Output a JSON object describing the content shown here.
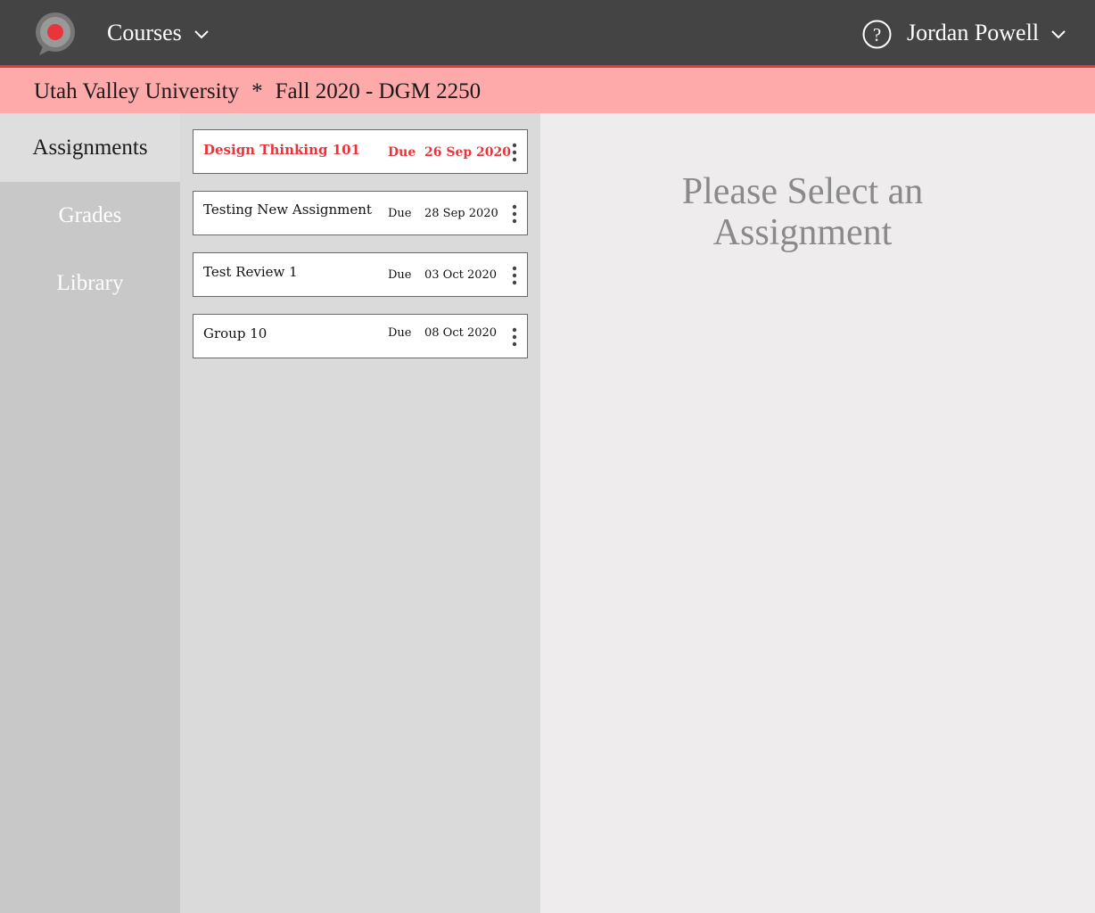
{
  "header": {
    "logo_icon": "chat-bubble-logo-icon",
    "courses_label": "Courses",
    "help_icon": "question-circle-icon",
    "user_name": "Jordan Powell"
  },
  "breadcrumb": {
    "institution": "Utah Valley University",
    "separator": "*",
    "course": "Fall 2020 - DGM 2250"
  },
  "sidebar": {
    "items": [
      {
        "label": "Assignments",
        "active": true
      },
      {
        "label": "Grades",
        "active": false
      },
      {
        "label": "Library",
        "active": false
      }
    ]
  },
  "assignments": [
    {
      "title": "Design Thinking 101",
      "due_label": "Due",
      "date": "26 Sep 2020",
      "highlighted": true
    },
    {
      "title": "Testing New Assignment",
      "due_label": "Due",
      "date": "28 Sep 2020",
      "highlighted": false
    },
    {
      "title": "Test Review 1",
      "due_label": "Due",
      "date": "03 Oct 2020",
      "highlighted": false
    },
    {
      "title": "Group 10",
      "due_label": "Due",
      "date": "08 Oct 2020",
      "highlighted": false
    }
  ],
  "main": {
    "placeholder_line1": "Please Select an",
    "placeholder_line2": "Assignment"
  },
  "colors": {
    "topbar": "#444444",
    "accent": "#e8353b",
    "breadcrumb_bg": "#ffaaaa",
    "sidebar_bg": "#c8c8c8",
    "list_bg": "#dadada",
    "main_bg": "#eeecec"
  }
}
